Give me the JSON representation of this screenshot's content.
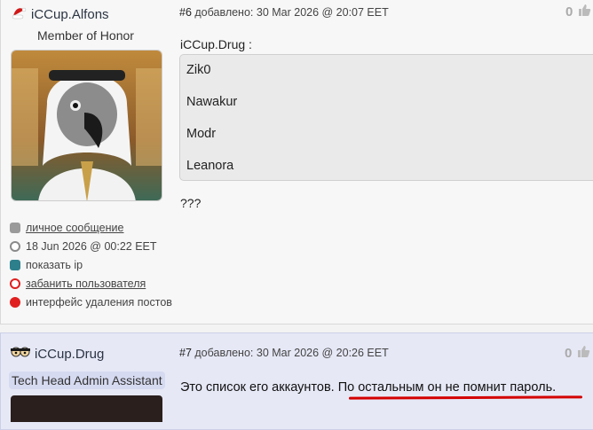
{
  "post1": {
    "author": "iCCup.Alfons",
    "rank": "Member of Honor",
    "meta_num": "#6",
    "meta_text": "добавлено: 30 Mar 2026 @ 20:07 EET",
    "votes": "0",
    "quote_author": "iCCup.Drug :",
    "quote_lines": [
      "Zik0",
      "Nawakur",
      "Modr",
      "Leanora"
    ],
    "body": "???",
    "side_links": [
      {
        "label": "личное сообщение",
        "icon": "mail-icon",
        "link": true
      },
      {
        "label": "18 Jun 2026 @ 00:22 EET",
        "icon": "clock-icon",
        "link": false
      },
      {
        "label": "показать ip",
        "icon": "monitor-icon",
        "link": false
      },
      {
        "label": "забанить пользователя",
        "icon": "power-icon",
        "link": true
      },
      {
        "label": "интерфейс удаления постов",
        "icon": "delete-icon",
        "link": false
      }
    ]
  },
  "post2": {
    "author": "iCCup.Drug",
    "rank": "Tech Head Admin Assistant",
    "meta_num": "#7",
    "meta_text": "добавлено: 30 Mar 2026 @ 20:26 EET",
    "votes": "0",
    "body_part1": "Это список его аккаунтов.",
    "body_part2": "По остальным он не помнит пароль."
  },
  "colors": {
    "accent_red": "#d40000",
    "post2_bg": "#e6e8f6",
    "post1_bg": "#f7f7f7"
  }
}
